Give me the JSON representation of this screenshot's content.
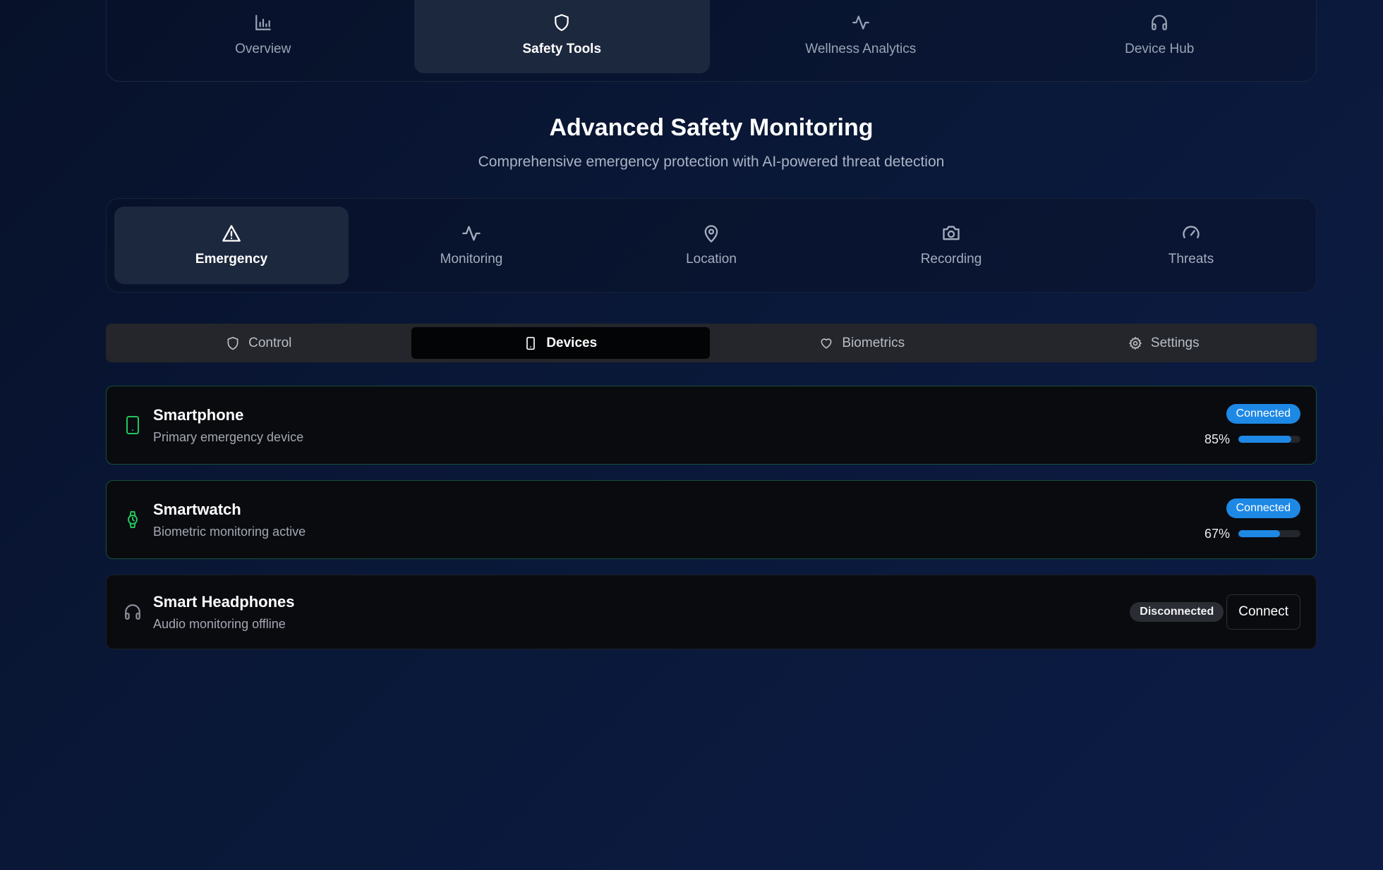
{
  "top_nav": {
    "tabs": [
      {
        "label": "Overview",
        "icon": "bar-chart-icon",
        "active": false
      },
      {
        "label": "Safety Tools",
        "icon": "shield-icon",
        "active": true
      },
      {
        "label": "Wellness Analytics",
        "icon": "activity-icon",
        "active": false
      },
      {
        "label": "Device Hub",
        "icon": "headphones-icon",
        "active": false
      }
    ]
  },
  "page": {
    "title": "Advanced Safety Monitoring",
    "subtitle": "Comprehensive emergency protection with AI-powered threat detection"
  },
  "section_tabs": [
    {
      "label": "Emergency",
      "icon": "alert-triangle-icon",
      "active": true
    },
    {
      "label": "Monitoring",
      "icon": "activity-icon",
      "active": false
    },
    {
      "label": "Location",
      "icon": "map-pin-icon",
      "active": false
    },
    {
      "label": "Recording",
      "icon": "camera-icon",
      "active": false
    },
    {
      "label": "Threats",
      "icon": "gauge-icon",
      "active": false
    }
  ],
  "sub_tabs": [
    {
      "label": "Control",
      "icon": "shield-icon",
      "active": false
    },
    {
      "label": "Devices",
      "icon": "smartphone-icon",
      "active": true
    },
    {
      "label": "Biometrics",
      "icon": "heart-icon",
      "active": false
    },
    {
      "label": "Settings",
      "icon": "gear-icon",
      "active": false
    }
  ],
  "devices": [
    {
      "name": "Smartphone",
      "description": "Primary emergency device",
      "status": "Connected",
      "battery_label": "85%",
      "battery": 0.85,
      "icon": "smartphone-icon",
      "icon_color": "#22c55e"
    },
    {
      "name": "Smartwatch",
      "description": "Biometric monitoring active",
      "status": "Connected",
      "battery_label": "67%",
      "battery": 0.67,
      "icon": "watch-icon",
      "icon_color": "#22c55e"
    },
    {
      "name": "Smart Headphones",
      "description": "Audio monitoring offline",
      "status": "Disconnected",
      "action": "Connect",
      "icon": "headphones-icon",
      "icon_color": "#8a8f99"
    }
  ],
  "colors": {
    "accent": "#1e88e5",
    "connected_icon": "#22c55e",
    "card_border_ok": "#15513a"
  }
}
